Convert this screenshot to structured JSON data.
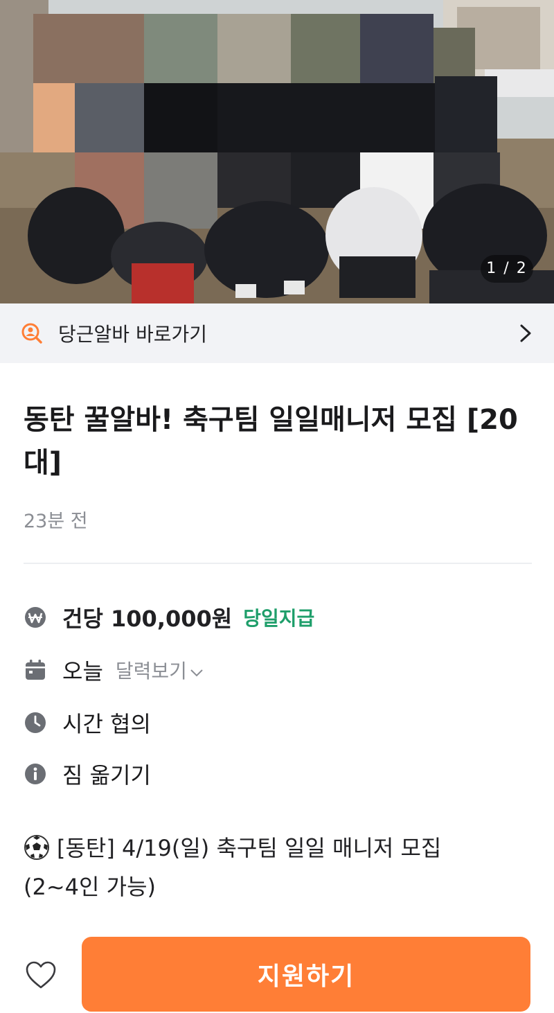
{
  "hero": {
    "page_indicator": "1 / 2"
  },
  "shortcut": {
    "label": "당근알바 바로가기",
    "icon": "search-person-icon"
  },
  "post": {
    "title": "동탄 꿀알바! 축구팀 일일매니저 모집 [20대]",
    "time_ago": "23분 전"
  },
  "info": {
    "pay": {
      "icon": "won-icon",
      "amount": "건당 100,000원",
      "badge": "당일지급"
    },
    "date": {
      "icon": "calendar-icon",
      "value": "오늘",
      "calendar_link": "달력보기"
    },
    "time": {
      "icon": "clock-icon",
      "value": "시간 협의"
    },
    "task": {
      "icon": "info-icon",
      "value": "짐 옮기기"
    }
  },
  "description": {
    "icon": "soccer-ball-icon",
    "line1": "[동탄] 4/19(일) 축구팀 일일 매니저 모집",
    "line2": "(2~4인 가능)"
  },
  "bottom": {
    "apply_label": "지원하기",
    "like_icon": "heart-icon"
  },
  "colors": {
    "accent": "#ff7e36",
    "badge_green": "#1e9e6a",
    "muted": "#8b8e94",
    "bar_bg": "#f2f3f6"
  }
}
